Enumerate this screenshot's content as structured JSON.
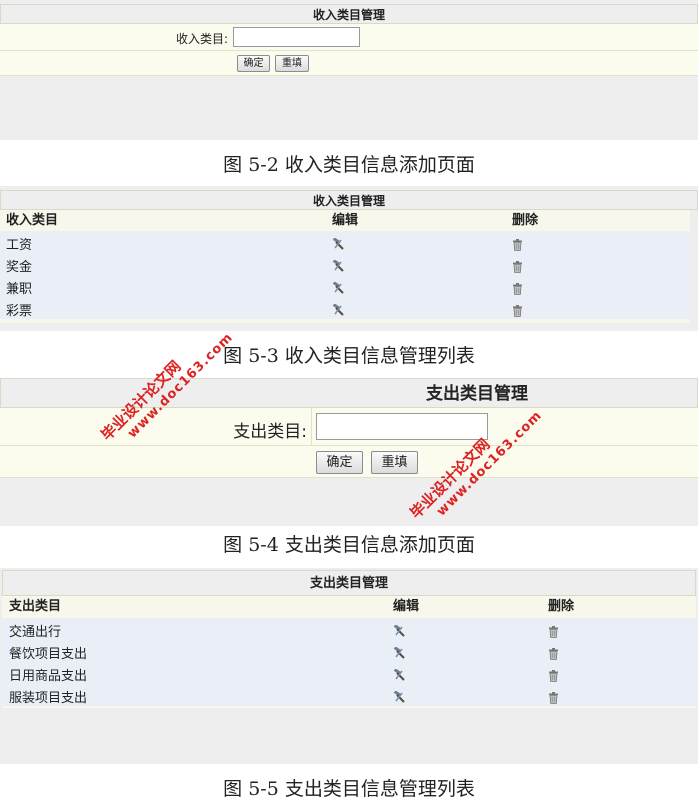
{
  "income_form": {
    "title": "收入类目管理",
    "field_label": "收入类目:",
    "field_value": "",
    "confirm_label": "确定",
    "reset_label": "重填"
  },
  "caption_2": "图 5-2 收入类目信息添加页面",
  "income_list": {
    "title": "收入类目管理",
    "columns": [
      "收入类目",
      "编辑",
      "删除"
    ],
    "rows": [
      "工资",
      "奖金",
      "兼职",
      "彩票"
    ]
  },
  "caption_3": "图 5-3 收入类目信息管理列表",
  "expense_form": {
    "title": "支出类目管理",
    "field_label": "支出类目:",
    "field_value": "",
    "confirm_label": "确定",
    "reset_label": "重填"
  },
  "caption_4": "图 5-4 支出类目信息添加页面",
  "expense_list": {
    "title": "支出类目管理",
    "columns": [
      "支出类目",
      "编辑",
      "删除"
    ],
    "rows": [
      "交通出行",
      "餐饮项目支出",
      "日用商品支出",
      "服装项目支出"
    ]
  },
  "caption_5": "图 5-5 支出类目信息管理列表",
  "watermark": {
    "cn": "毕业设计论文网",
    "url": "www.doc163.com"
  },
  "icons": {
    "edit": "hammer-icon",
    "delete": "trash-icon"
  },
  "colors": {
    "header_bg": "#eeeeee",
    "form_row_bg": "#fbfbee",
    "list_row_bg": "#e9eef7",
    "watermark": "#dd2222"
  }
}
